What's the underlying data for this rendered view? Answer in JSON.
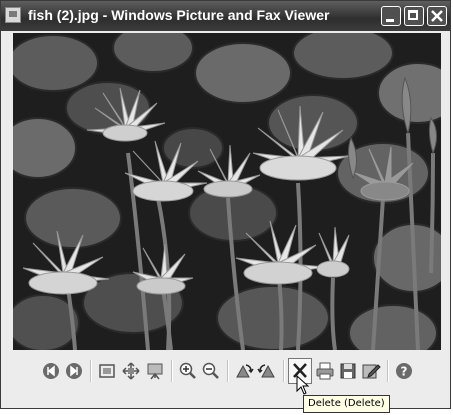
{
  "window": {
    "title": "fish (2).jpg - Windows Picture and Fax Viewer",
    "controls": [
      "minimize",
      "maximize",
      "close"
    ]
  },
  "image": {
    "subject": "water lilies and lily pads",
    "palette": {
      "background": "#222222",
      "pads": "#5a5a5a",
      "petals": "#e4e4e4"
    }
  },
  "toolbar": {
    "buttons": [
      {
        "icon": "previous-image-icon"
      },
      {
        "icon": "next-image-icon"
      },
      {
        "icon": "best-fit-icon"
      },
      {
        "icon": "actual-size-icon"
      },
      {
        "icon": "slideshow-icon"
      },
      {
        "icon": "zoom-in-icon"
      },
      {
        "icon": "zoom-out-icon"
      },
      {
        "icon": "rotate-clockwise-icon"
      },
      {
        "icon": "rotate-counterclockwise-icon"
      },
      {
        "icon": "delete-icon"
      },
      {
        "icon": "print-icon"
      },
      {
        "icon": "save-icon"
      },
      {
        "icon": "edit-icon"
      },
      {
        "icon": "help-icon"
      }
    ]
  },
  "tooltip": {
    "text": "Delete (Delete)"
  }
}
